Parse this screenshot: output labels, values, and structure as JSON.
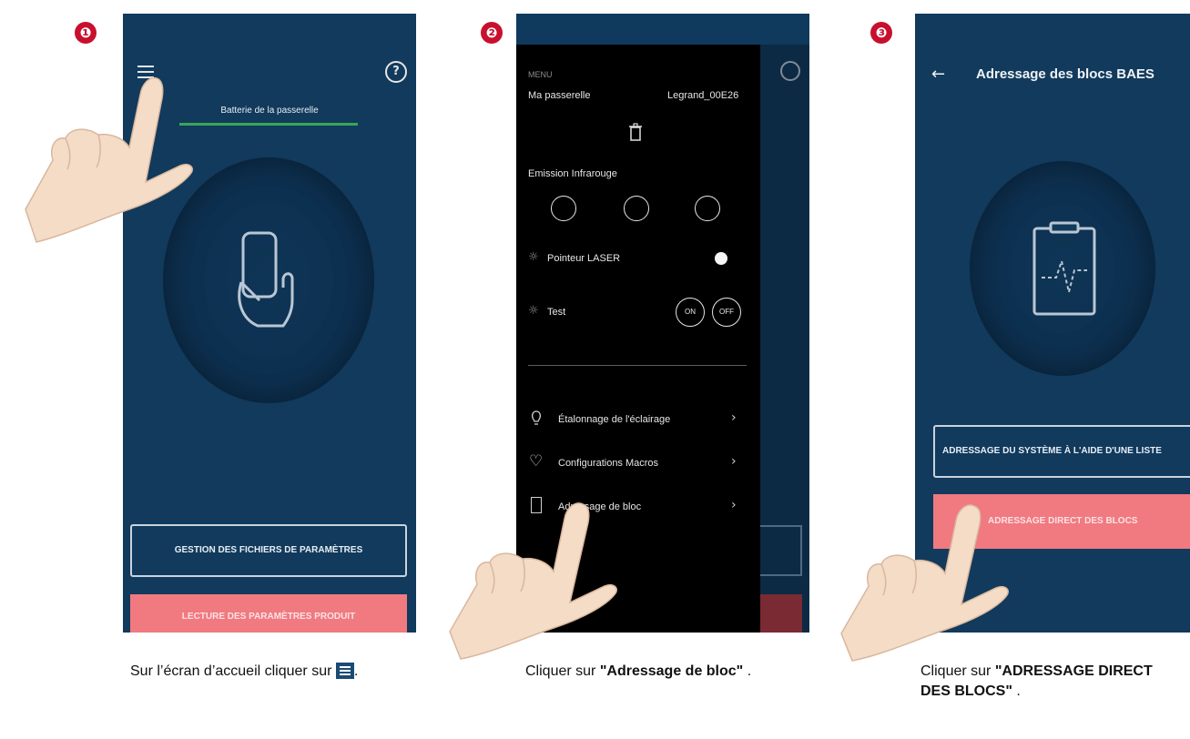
{
  "steps": [
    "❶",
    "❷",
    "❸"
  ],
  "screen1": {
    "battery_label": "Batterie de la passerelle",
    "btn_files": "GESTION DES FICHIERS DE PARAMÈTRES",
    "btn_read": "LECTURE DES PARAMÈTRES PRODUIT",
    "help_symbol": "?"
  },
  "screen2": {
    "menu_label": "MENU",
    "gateway_label": "Ma passerelle",
    "gateway_name": "Legrand_00E26",
    "ir_label": "Emission Infrarouge",
    "laser_label": "Pointeur LASER",
    "test_label": "Test",
    "on_label": "ON",
    "off_label": "OFF",
    "items": [
      "Étalonnage de l'éclairage",
      "Configurations Macros",
      "Adressage de bloc"
    ],
    "help_symbol": "?"
  },
  "screen3": {
    "title": "Adressage des blocs BAES",
    "btn_list": "ADRESSAGE DU SYSTÈME À L'AIDE D'UNE LISTE",
    "btn_direct": "ADRESSAGE DIRECT DES BLOCS"
  },
  "captions": {
    "c1_text": "Sur l’écran d’accueil cliquer sur",
    "c1_end": ".",
    "c2_pre": "Cliquer sur ",
    "c2_bold": "\"Adressage de bloc\"",
    "c2_end": " .",
    "c3_pre": "Cliquer sur ",
    "c3_bold1": "\"ADRESSAGE DIRECT",
    "c3_bold2": "DES BLOCS\"",
    "c3_end": " ."
  },
  "colors": {
    "screen_bg": "#113a5c",
    "menu_bg": "#000000",
    "accent_pink": "#f07a80",
    "battery_green": "#3aa655",
    "step_red": "#c8102e"
  }
}
